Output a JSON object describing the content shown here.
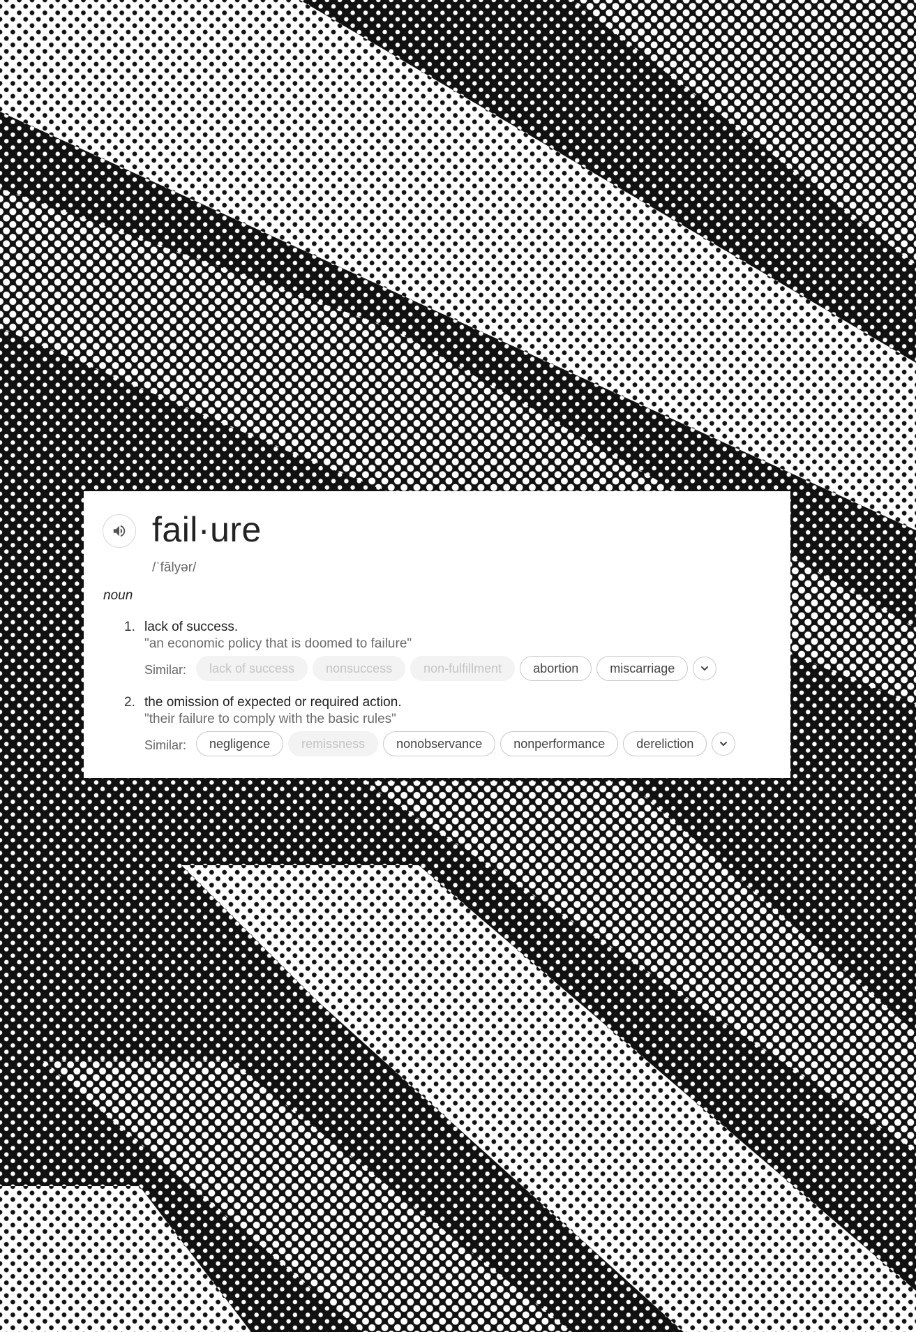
{
  "entry": {
    "word": "fail·ure",
    "pronunciation": "/ˈfālyər/",
    "part_of_speech": "noun",
    "senses": [
      {
        "number": "1.",
        "definition": "lack of success.",
        "example": "\"an economic policy that is doomed to failure\"",
        "similar_label": "Similar:",
        "similar": [
          {
            "text": "lack of success",
            "muted": true
          },
          {
            "text": "nonsuccess",
            "muted": true
          },
          {
            "text": "non-fulfillment",
            "muted": true
          },
          {
            "text": "abortion",
            "muted": false
          },
          {
            "text": "miscarriage",
            "muted": false
          }
        ]
      },
      {
        "number": "2.",
        "definition": "the omission of expected or required action.",
        "example": "\"their failure to comply with the basic rules\"",
        "similar_label": "Similar:",
        "similar": [
          {
            "text": "negligence",
            "muted": false
          },
          {
            "text": "remissness",
            "muted": true
          },
          {
            "text": "nonobservance",
            "muted": false
          },
          {
            "text": "nonperformance",
            "muted": false
          },
          {
            "text": "dereliction",
            "muted": false
          }
        ]
      }
    ]
  },
  "icons": {
    "speaker": "speaker-icon",
    "expand": "chevron-down-icon"
  },
  "colors": {
    "background_ink": "#111111",
    "paper": "#ffffff",
    "card": "#ffffff"
  }
}
